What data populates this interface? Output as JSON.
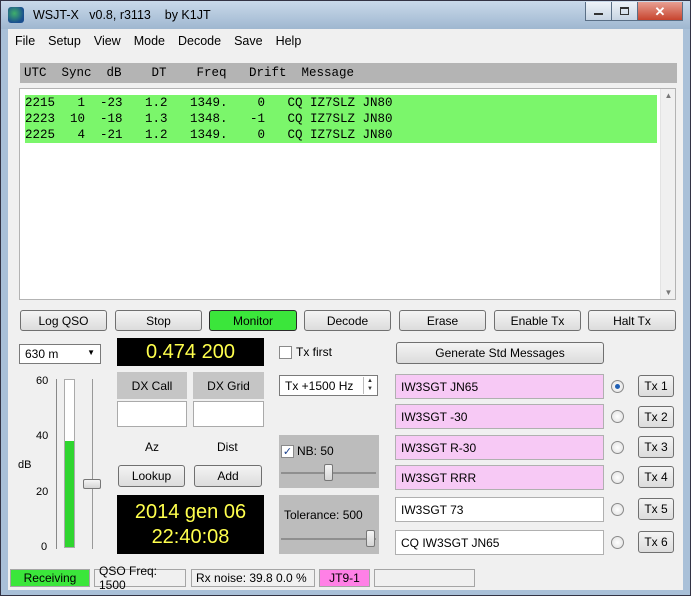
{
  "window": {
    "title": "WSJT-X   v0.8, r3113    by K1JT"
  },
  "menu": [
    "File",
    "Setup",
    "View",
    "Mode",
    "Decode",
    "Save",
    "Help"
  ],
  "decode_header": "UTC  Sync  dB    DT    Freq   Drift  Message",
  "decodes": [
    "2215   1  -23   1.2   1349.    0   CQ IZ7SLZ JN80",
    "2223  10  -18   1.3   1348.   -1   CQ IZ7SLZ JN80",
    "2225   4  -21   1.2   1349.    0   CQ IZ7SLZ JN80"
  ],
  "buttons": {
    "log_qso": "Log QSO",
    "stop": "Stop",
    "monitor": "Monitor",
    "decode": "Decode",
    "erase": "Erase",
    "enable_tx": "Enable Tx",
    "halt_tx": "Halt Tx",
    "lookup": "Lookup",
    "add": "Add",
    "generate": "Generate Std Messages"
  },
  "band": "630 m",
  "frequency": "0.474 200",
  "level_meter": {
    "scale": [
      "60",
      "40",
      "20",
      "0"
    ],
    "unit": "dB",
    "level": 38,
    "max": 60
  },
  "dx": {
    "call_label": "DX Call",
    "grid_label": "DX Grid",
    "call_value": "",
    "grid_value": "",
    "az_label": "Az",
    "dist_label": "Dist"
  },
  "clock": {
    "date": "2014 gen 06",
    "time": "22:40:08"
  },
  "tx_first_label": "Tx first",
  "tx_offset": "Tx +1500  Hz",
  "nb": {
    "label": "NB: 50",
    "checked": true,
    "value": 50
  },
  "tolerance": {
    "label": "Tolerance: 500"
  },
  "messages": [
    {
      "text": "IW3SGT JN65",
      "tx_label": "Tx 1",
      "selected": true,
      "color": "#f7c9f5"
    },
    {
      "text": "IW3SGT -30",
      "tx_label": "Tx 2",
      "selected": false,
      "color": "#f7c9f5"
    },
    {
      "text": "IW3SGT R-30",
      "tx_label": "Tx 3",
      "selected": false,
      "color": "#f7c9f5"
    },
    {
      "text": "IW3SGT RRR",
      "tx_label": "Tx 4",
      "selected": false,
      "color": "#f7c9f5"
    },
    {
      "text": "IW3SGT 73",
      "tx_label": "Tx 5",
      "selected": false,
      "color": "#ffffff"
    },
    {
      "text": "CQ IW3SGT JN65",
      "tx_label": "Tx 6",
      "selected": false,
      "color": "#ffffff"
    }
  ],
  "status": {
    "mode_state": "Receiving",
    "qso_freq": "QSO Freq:  1500",
    "rx_noise": "Rx noise:  39.8    0.0 %",
    "mode": "JT9-1",
    "extra": ""
  },
  "colors": {
    "decode_row": "#7bf66b",
    "monitor_active": "#3be63b",
    "receiving": "#3be63b",
    "mode_badge": "#ff80e6",
    "display_text": "#ffff4d"
  }
}
